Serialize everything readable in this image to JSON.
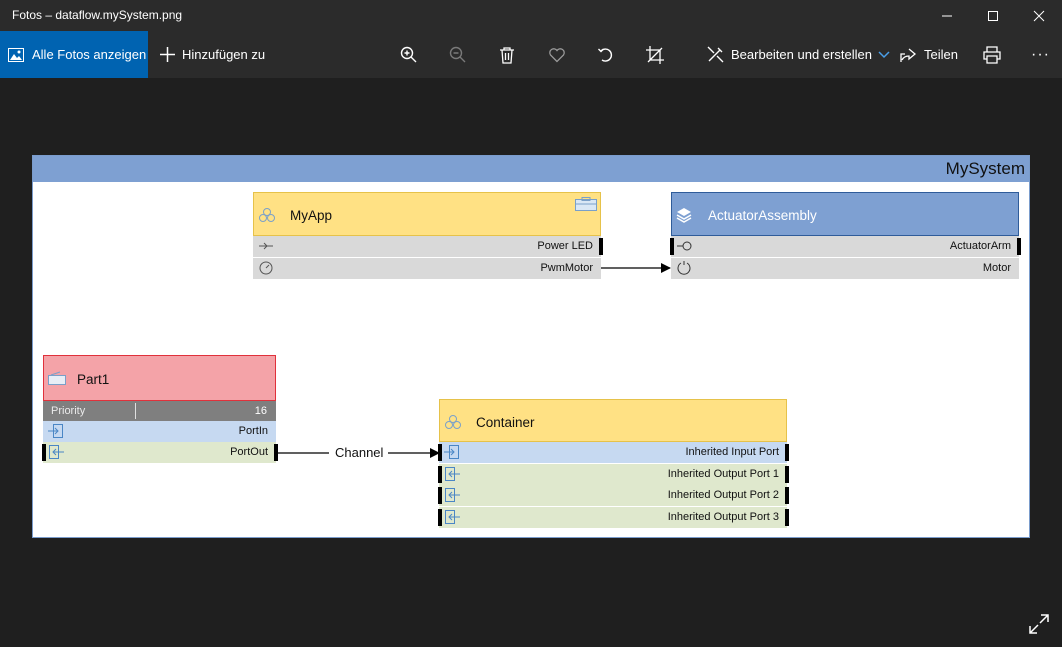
{
  "window": {
    "title": "Fotos – dataflow.mySystem.png",
    "controls": [
      "minimize",
      "maximize",
      "close"
    ]
  },
  "toolbar": {
    "all_photos_label": "Alle Fotos anzeigen",
    "add_to_label": "Hinzufügen zu",
    "edit_create_label": "Bearbeiten und erstellen",
    "share_label": "Teilen",
    "more_label": "···",
    "icons": [
      "zoom-in-icon",
      "zoom-out-icon",
      "delete-icon",
      "favorite-icon",
      "rotate-icon",
      "crop-icon",
      "print-icon"
    ]
  },
  "diagram": {
    "system_name": "MySystem",
    "blocks": {
      "myapp": {
        "name": "MyApp",
        "ports": [
          "Power LED",
          "PwmMotor"
        ]
      },
      "actuator": {
        "name": "ActuatorAssembly",
        "ports": [
          "ActuatorArm",
          "Motor"
        ]
      },
      "part1": {
        "name": "Part1",
        "property": {
          "label": "Priority",
          "value": "16"
        },
        "ports": [
          "PortIn",
          "PortOut"
        ]
      },
      "container": {
        "name": "Container",
        "ports": [
          "Inherited Input Port",
          "Inherited Output Port 1",
          "Inherited Output Port 2",
          "Inherited Output Port 3"
        ]
      }
    },
    "connections": [
      {
        "from": "PwmMotor",
        "to": "Motor",
        "label": ""
      },
      {
        "from": "PortOut",
        "to": "Inherited Input Port",
        "label": "Channel"
      }
    ],
    "colors": {
      "app_block": "#ffe184",
      "assembly_block": "#7ea0d2",
      "part_block": "#f4a3a8",
      "input_port_row": "#c6d9f1",
      "output_port_row": "#dfe8cd",
      "neutral_port_row": "#d9d9d9",
      "property_row": "#7f7f7f",
      "accent": "#0063b1"
    }
  }
}
